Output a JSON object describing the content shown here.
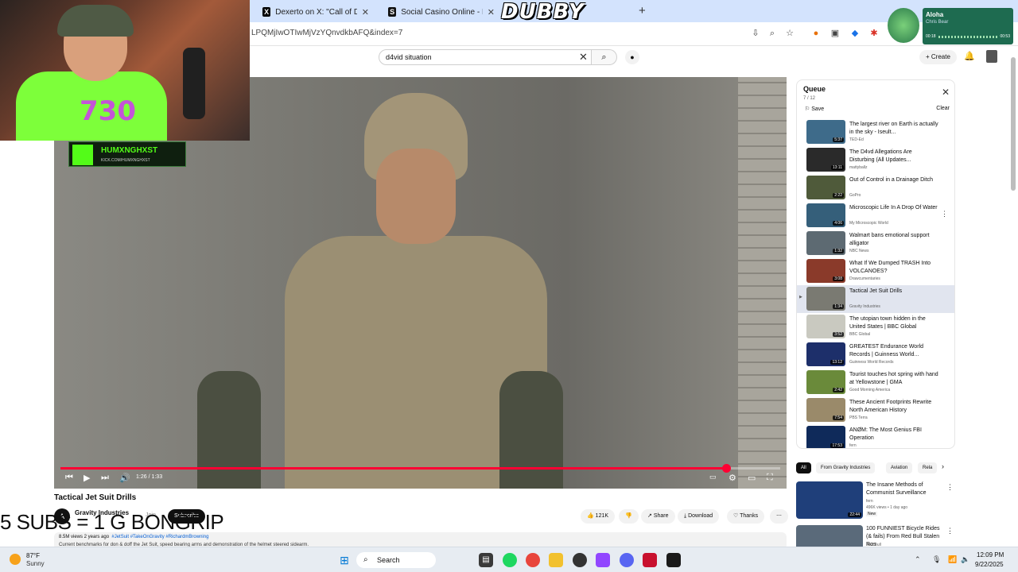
{
  "browser": {
    "tabs": [
      {
        "label": "Dexerto on X: \"Call of Duty: Bla",
        "icon": "x-logo-icon"
      },
      {
        "label": "Social Casino Online - Best Soc",
        "icon": "s-logo-icon"
      }
    ],
    "new_tab": "+",
    "url": "LPQMjIwOTIwMjVzYQnvdkbAFQ&index=7"
  },
  "youtube": {
    "search_value": "d4vid situation",
    "create_label": "Create"
  },
  "overlay": {
    "dubby": "DUBBY",
    "shirt_number": "730",
    "kick_name": "HUMXNGHXST",
    "kick_url": "KICK.COM/HUMXNGHXST",
    "promo": "5 SUBS = 1 G BONGRIP"
  },
  "music_widget": {
    "title": "Aloha",
    "artist": "Chris Bear",
    "elapsed": "00:18",
    "total": "00:53"
  },
  "player": {
    "time": "1:26 / 1:33",
    "progress": 0.925
  },
  "video": {
    "title": "Tactical Jet Suit Drills",
    "channel": "Gravity Industries",
    "channel_initial": "A",
    "join": "Join",
    "subscribe": "Subscribe",
    "likes": "121K",
    "share": "Share",
    "download": "Download",
    "thanks": "Thanks",
    "views_date": "8.5M views  2 years ago",
    "tags": "#JetSuit #TakeOnGravity #RichardmBrowning",
    "description_line": "Current benchmarks for don & doff the Jet Suit, speed bearing arms and demonstration of the helmet steered sidearm."
  },
  "queue": {
    "title": "Queue",
    "count": "7 / 12",
    "save": "Save",
    "clear": "Clear",
    "items": [
      {
        "title": "The largest river on Earth is actually in the sky - Iseult...",
        "channel": "TED-Ed",
        "duration": "5:37",
        "color": "#3e6b8a"
      },
      {
        "title": "The D4vd Allegations Are Disturbing (All Updates...",
        "channel": "mattyballz",
        "duration": "13:11",
        "color": "#2a2a2a"
      },
      {
        "title": "Out of Control in a Drainage Ditch",
        "channel": "GoPro",
        "duration": "2:22",
        "color": "#4f5a3a"
      },
      {
        "title": "Microscopic Life In A Drop Of Water",
        "channel": "My Microscopic World",
        "duration": "4:06",
        "color": "#355f7a"
      },
      {
        "title": "Walmart bans emotional support alligator",
        "channel": "NBC News",
        "duration": "1:32",
        "color": "#5d6a72"
      },
      {
        "title": "What If We Dumped TRASH Into VOLCANOES?",
        "channel": "Drawcumentaries",
        "duration": "3:08",
        "color": "#8a3a2a"
      },
      {
        "title": "Tactical Jet Suit Drills",
        "channel": "Gravity Industries",
        "duration": "1:34",
        "color": "#7a7a72",
        "active": true
      },
      {
        "title": "The utopian town hidden in the United States | BBC Global",
        "channel": "BBC Global",
        "duration": "3:52",
        "color": "#c9c9c0"
      },
      {
        "title": "GREATEST Endurance World Records | Guinness World...",
        "channel": "Guinness World Records",
        "duration": "13:12",
        "color": "#1d2f6a"
      },
      {
        "title": "Tourist touches hot spring with hand at Yellowstone | GMA",
        "channel": "Good Morning America",
        "duration": "2:42",
        "color": "#6a8a3a"
      },
      {
        "title": "These Ancient Footprints Rewrite North American History",
        "channel": "PBS Terra",
        "duration": "7:54",
        "color": "#9a8a6a"
      },
      {
        "title": "ANØM: The Most Genius FBI Operation",
        "channel": "fern",
        "duration": "17:53",
        "color": "#0f2a5a"
      }
    ]
  },
  "chips": [
    "All",
    "From Gravity Industries",
    "Aviation",
    "Rela"
  ],
  "recommended": [
    {
      "title": "The Insane Methods of Communist Surveillance",
      "channel": "fern",
      "meta": "496K views • 1 day ago",
      "badge": "New",
      "duration": "22:44",
      "color": "#1f3f7a"
    },
    {
      "title": "100 FUNNIEST Bicycle Rides (& fails) From Red Bull Stalen Ros",
      "channel": "Red Bull",
      "meta": "",
      "badge": "",
      "duration": "",
      "color": "#5a6a7a"
    }
  ],
  "taskbar": {
    "temp": "87°F",
    "condition": "Sunny",
    "search": "Search",
    "time": "12:09 PM",
    "date": "9/22/2025"
  }
}
